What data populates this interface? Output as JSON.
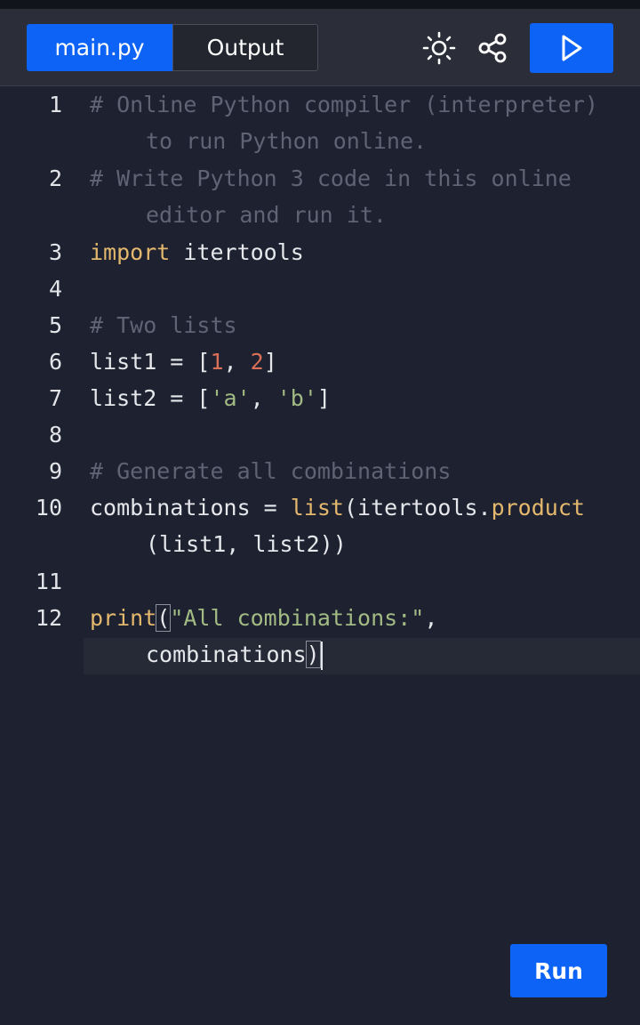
{
  "tabs": {
    "main_label": "main.py",
    "output_label": "Output"
  },
  "toolbar": {
    "icons": [
      "theme-toggle-icon",
      "share-icon",
      "play-icon"
    ]
  },
  "editor": {
    "lines": [
      {
        "num": "1",
        "segments": [
          {
            "t": "# Online Python compiler (interpreter)",
            "c": "cmt"
          }
        ],
        "cont": [
          {
            "t": "to run Python online.",
            "c": "cmt"
          }
        ]
      },
      {
        "num": "2",
        "segments": [
          {
            "t": "# Write Python 3 code in this online",
            "c": "cmt"
          }
        ],
        "cont": [
          {
            "t": "editor and run it.",
            "c": "cmt"
          }
        ]
      },
      {
        "num": "3",
        "segments": [
          {
            "t": "import",
            "c": "kw"
          },
          {
            "t": " itertools",
            "c": ""
          }
        ]
      },
      {
        "num": "4",
        "segments": []
      },
      {
        "num": "5",
        "segments": [
          {
            "t": "# Two lists",
            "c": "cmt"
          }
        ]
      },
      {
        "num": "6",
        "segments": [
          {
            "t": "list1 = [",
            "c": ""
          },
          {
            "t": "1",
            "c": "num"
          },
          {
            "t": ", ",
            "c": ""
          },
          {
            "t": "2",
            "c": "num"
          },
          {
            "t": "]",
            "c": ""
          }
        ]
      },
      {
        "num": "7",
        "segments": [
          {
            "t": "list2 = [",
            "c": ""
          },
          {
            "t": "'a'",
            "c": "str"
          },
          {
            "t": ", ",
            "c": ""
          },
          {
            "t": "'b'",
            "c": "str"
          },
          {
            "t": "]",
            "c": ""
          }
        ]
      },
      {
        "num": "8",
        "segments": []
      },
      {
        "num": "9",
        "segments": [
          {
            "t": "# Generate all combinations",
            "c": "cmt"
          }
        ]
      },
      {
        "num": "10",
        "segments": [
          {
            "t": "combinations = ",
            "c": ""
          },
          {
            "t": "list",
            "c": "fn"
          },
          {
            "t": "(itertools.",
            "c": ""
          },
          {
            "t": "product",
            "c": "fn"
          }
        ],
        "cont": [
          {
            "t": "(list1, list2))",
            "c": ""
          }
        ]
      },
      {
        "num": "11",
        "segments": []
      },
      {
        "num": "12",
        "segments": [
          {
            "t": "print",
            "c": "fn"
          },
          {
            "t": "(",
            "c": "bracket"
          },
          {
            "t": "\"All combinations:\"",
            "c": "str"
          },
          {
            "t": ",",
            "c": ""
          }
        ],
        "cont": [
          {
            "t": "combinations",
            "c": ""
          },
          {
            "t": ")",
            "c": "bracket"
          }
        ],
        "cursor": true
      }
    ]
  },
  "run_button": {
    "label": "Run"
  },
  "colors": {
    "accent": "#0d63f5",
    "background": "#1d2130",
    "toolbar": "#2b2e38"
  }
}
